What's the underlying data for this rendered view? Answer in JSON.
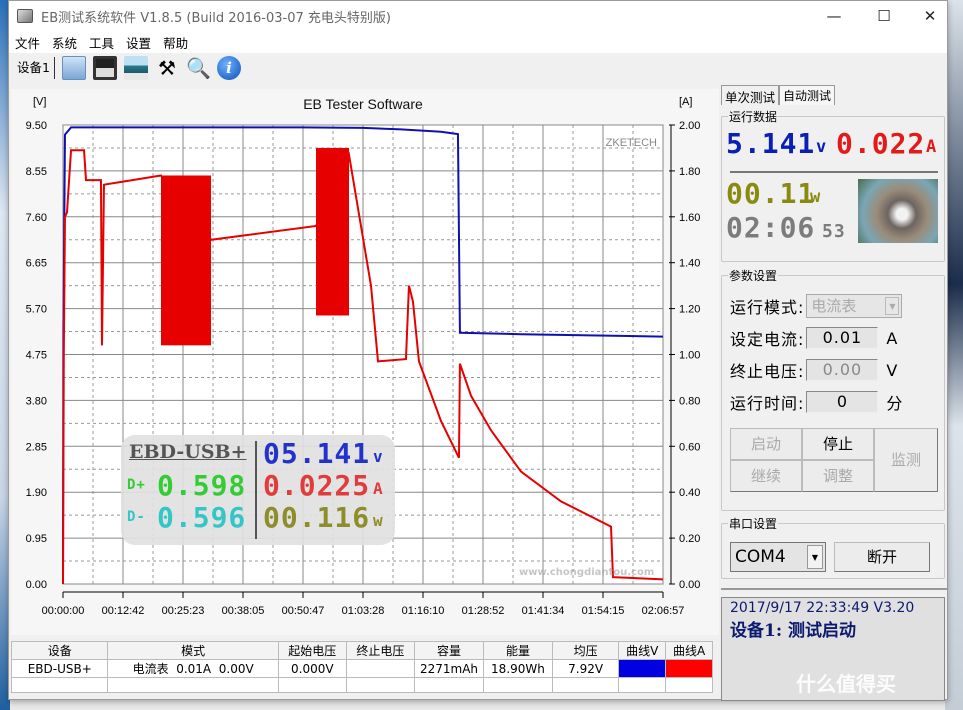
{
  "window": {
    "title": "EB测试系统软件 V1.8.5 (Build 2016-03-07 充电头特别版)",
    "minimize": "—",
    "maximize": "☐",
    "close": "✕"
  },
  "menu": [
    "文件",
    "系统",
    "工具",
    "设置",
    "帮助"
  ],
  "toolbar": {
    "device_tab": "设备1",
    "icons": [
      "folder-icon",
      "save-icon",
      "image-icon",
      "tools-icon",
      "search-icon",
      "info-icon"
    ]
  },
  "chart_data": {
    "type": "line",
    "title": "EB Tester Software",
    "watermark": "ZKETECH",
    "y_left_label": "[V]",
    "y_right_label": "[A]",
    "y_left_ticks": [
      "9.50",
      "8.55",
      "7.60",
      "6.65",
      "5.70",
      "4.75",
      "3.80",
      "2.85",
      "1.90",
      "0.95",
      "0.00"
    ],
    "y_right_ticks": [
      "2.00",
      "1.80",
      "1.60",
      "1.40",
      "1.20",
      "1.00",
      "0.80",
      "0.60",
      "0.40",
      "0.20",
      "0.00"
    ],
    "x_ticks": [
      "00:00:00",
      "00:12:42",
      "00:25:23",
      "00:38:05",
      "00:50:47",
      "01:03:28",
      "01:16:10",
      "01:28:52",
      "01:41:34",
      "01:54:15",
      "02:06:57"
    ],
    "ylim_left": [
      0,
      9.5
    ],
    "ylim_right": [
      0,
      2.0
    ],
    "xlim": [
      "00:00:00",
      "02:06:57"
    ],
    "grid": true,
    "series": [
      {
        "axis": "left",
        "color": "#1010b0",
        "points": [
          [
            "00:00:00",
            0
          ],
          [
            "00:00:05",
            5.2
          ],
          [
            "00:00:25",
            9.3
          ],
          [
            "00:01:42",
            9.45
          ],
          [
            "00:50:21",
            9.45
          ],
          [
            "01:03:30",
            9.44
          ],
          [
            "01:11:31",
            9.41
          ],
          [
            "01:19:59",
            9.36
          ],
          [
            "01:23:34",
            9.31
          ],
          [
            "01:23:59",
            5.2
          ],
          [
            "01:36:54",
            5.17
          ],
          [
            "02:06:57",
            5.12
          ]
        ]
      },
      {
        "axis": "right",
        "color": "#e60000",
        "points": [
          [
            "00:00:00",
            0
          ],
          [
            "00:00:10",
            1.0
          ],
          [
            "00:00:25",
            1.6
          ],
          [
            "00:00:51",
            1.62
          ],
          [
            "00:01:42",
            1.89
          ],
          [
            "00:04:27",
            1.89
          ],
          [
            "00:04:52",
            1.76
          ],
          [
            "00:08:02",
            1.76
          ],
          [
            "00:08:15",
            1.04
          ],
          [
            "00:08:40",
            1.74
          ],
          [
            "00:20:44",
            1.78
          ],
          [
            "00:31:19",
            1.5
          ],
          [
            "00:53:32",
            1.56
          ],
          [
            "01:00:31",
            1.87
          ],
          [
            "01:05:10",
            1.3
          ],
          [
            "01:06:39",
            0.97
          ],
          [
            "01:12:34",
            0.98
          ],
          [
            "01:13:12",
            1.3
          ],
          [
            "01:14:03",
            1.23
          ],
          [
            "01:15:19",
            0.97
          ],
          [
            "01:19:59",
            0.71
          ],
          [
            "01:23:47",
            0.55
          ],
          [
            "01:23:59",
            0.96
          ],
          [
            "01:26:20",
            0.82
          ],
          [
            "01:30:33",
            0.67
          ],
          [
            "01:36:54",
            0.49
          ],
          [
            "01:45:22",
            0.36
          ],
          [
            "01:55:57",
            0.25
          ],
          [
            "01:56:22",
            0.03
          ],
          [
            "02:06:57",
            0.02
          ]
        ],
        "bands": [
          {
            "start": "00:20:44",
            "end": "00:31:19",
            "min": 1.04,
            "max": 1.78
          },
          {
            "start": "00:53:32",
            "end": "01:00:31",
            "min": 1.17,
            "max": 1.9
          }
        ]
      }
    ]
  },
  "overlay": {
    "device": "EBD-USB+",
    "voltage": "05.141",
    "voltage_unit": "v",
    "dplus_label": "D+",
    "dplus": "0.598",
    "current": "0.0225",
    "current_unit": "A",
    "dminus_label": "D-",
    "dminus": "0.596",
    "power": "00.116",
    "power_unit": "w"
  },
  "watermark2": {
    "url": "www.chongdiantou.com",
    "corner": "什么值得买"
  },
  "table": {
    "headers": [
      "设备",
      "模式",
      "起始电压",
      "终止电压",
      "容量",
      "能量",
      "均压",
      "曲线V",
      "曲线A"
    ],
    "rows": [
      [
        "EBD-USB+",
        "电流表  0.01A  0.00V",
        "0.000V",
        "",
        "2271mAh",
        "18.90Wh",
        "7.92V",
        "",
        ""
      ]
    ],
    "curve_v_color": "#0000e0",
    "curve_a_color": "#ff0000"
  },
  "right": {
    "tabs": [
      "单次测试",
      "自动测试"
    ],
    "run_data": {
      "label": "运行数据",
      "voltage": "5.141",
      "voltage_unit": "v",
      "current": "0.022",
      "current_unit": "A",
      "power": "00.11",
      "power_unit": "w",
      "time": "02:06",
      "time_sec": "53"
    },
    "params": {
      "label": "参数设置",
      "mode_label": "运行模式:",
      "mode_value": "电流表",
      "current_label": "设定电流:",
      "current_value": "0.01",
      "current_unit": "A",
      "cutoff_label": "终止电压:",
      "cutoff_value": "0.00",
      "cutoff_unit": "V",
      "time_label": "运行时间:",
      "time_value": "0",
      "time_unit": "分",
      "buttons": {
        "start": "启动",
        "stop": "停止",
        "monitor": "监测",
        "resume": "继续",
        "adjust": "调整"
      }
    },
    "serial": {
      "label": "串口设置",
      "port": "COM4",
      "disconnect": "断开"
    },
    "status": {
      "line1": "2017/9/17 22:33:49  V3.20",
      "line2": "设备1: 测试启动"
    }
  }
}
